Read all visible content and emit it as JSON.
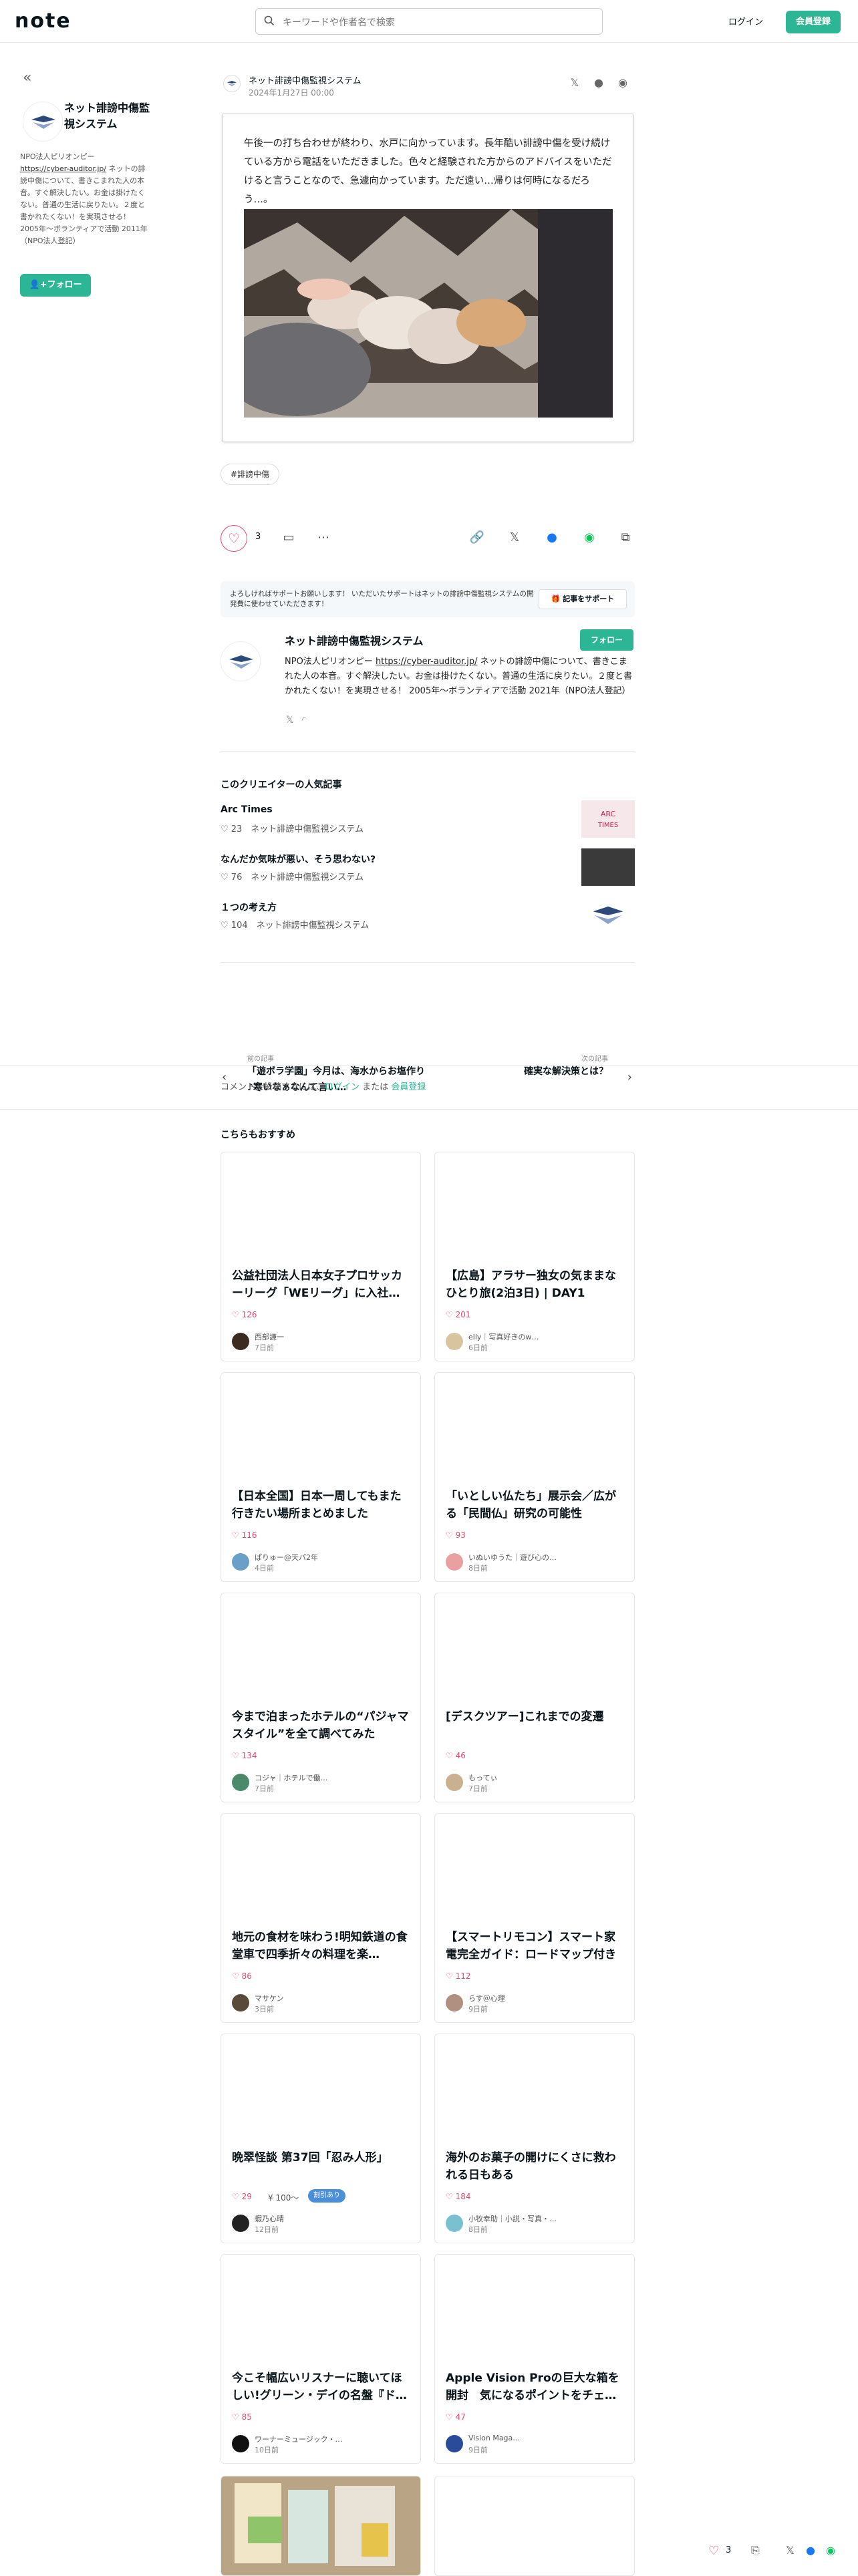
{
  "header": {
    "logo": "note",
    "search_placeholder": "キーワードや作者名で検索",
    "login": "ログイン",
    "signup": "会員登録"
  },
  "sidebar": {
    "name": "ネット誹謗中傷監視システム",
    "bio_pre": "NPO法人ピリオンピー",
    "bio_link": "https://cyber-auditor.jp/",
    "bio_post": " ネットの誹謗中傷について、書きこまれた人の本音。すぐ解決したい。お金は掛けたくない。普通の生活に戻りたい。２度と書かれたくない！を実現させる！ 2005年〜ボランティアで活動 2011年（NPO法人登記）",
    "follow": "フォロー"
  },
  "article": {
    "author": "ネット誹謗中傷監視システム",
    "date": "2024年1月27日 00:00",
    "body": "午後一の打ち合わせが終わり、水戸に向かっています。長年酷い誹謗中傷を受け続けている方から電話をいただきました。色々と経験された方からのアドバイスをいただけると言うことなので、急遽向かっています。ただ遠い…帰りは何時になるだろう…。",
    "tag": "#誹謗中傷",
    "likes": "3"
  },
  "support": {
    "text": "よろしければサポートお願いします！ いただいたサポートはネットの誹謗中傷監視システムの開発費に使わせていただきます！",
    "button": "記事をサポート"
  },
  "profile": {
    "name": "ネット誹謗中傷監視システム",
    "follow": "フォロー",
    "bio_pre": "NPO法人ピリオンピー ",
    "bio_link": "https://cyber-auditor.jp/",
    "bio_post": " ネットの誹謗中傷について、書きこまれた人の本音。すぐ解決したい。お金は掛けたくない。普通の生活に戻りたい。２度と書かれたくない！を実現させる！ 2005年〜ボランティアで活動 2021年（NPO法人登記）"
  },
  "popular": {
    "title": "このクリエイターの人気記事",
    "items": [
      {
        "title": "Arc Times",
        "likes": "23",
        "author": "ネット誹謗中傷監視システム"
      },
      {
        "title": "なんだか気味が悪い、そう思わない?",
        "likes": "76",
        "author": "ネット誹謗中傷監視システム"
      },
      {
        "title": "１つの考え方",
        "likes": "104",
        "author": "ネット誹謗中傷監視システム"
      }
    ]
  },
  "nav": {
    "prev_label": "前の記事",
    "prev_title": "「遊ボラ学園」今月は、海水からお塩作り♪寒いなぁなんて言い…",
    "next_label": "次の記事",
    "next_title": "確実な解決策とは？"
  },
  "comment": {
    "pre": "コメントを投稿するには、",
    "login": "ログイン",
    "mid": " または ",
    "signup": "会員登録"
  },
  "recommend": {
    "title": "こちらもおすすめ",
    "cards": [
      {
        "title": "公益社団法人日本女子プロサッカーリーグ「WEリーグ」に入社…",
        "likes": "126",
        "user": "西部謙一",
        "date": "7日前",
        "avatar": "#3a2a20"
      },
      {
        "title": "【広島】アラサー独女の気ままなひとり旅(2泊3日) | DAY1",
        "likes": "201",
        "user": "elly｜写真好きのw…",
        "date": "6日前",
        "avatar": "#d9c4a0"
      },
      {
        "title": "【日本全国】日本一周してもまた行きたい場所まとめました",
        "likes": "116",
        "user": "ぱりゅー@天パ2年",
        "date": "4日前",
        "avatar": "#6aa0c8"
      },
      {
        "title": "「いとしい仏たち」展示会／広がる「民間仏」研究の可能性",
        "likes": "93",
        "user": "いぬいゆうた｜遊び心の…",
        "date": "8日前",
        "avatar": "#e8a0a0"
      },
      {
        "title": "今まで泊まったホテルの“パジャマスタイル”を全て調べてみた",
        "likes": "134",
        "user": "コジャ｜ホテルで働…",
        "date": "7日前",
        "avatar": "#4a8a6a"
      },
      {
        "title": "[デスクツアー]これまでの変遷",
        "likes": "46",
        "user": "もってぃ",
        "date": "7日前",
        "avatar": "#c8b090"
      },
      {
        "title": "地元の食材を味わう!明知鉄道の食堂車で四季折々の料理を楽…",
        "likes": "86",
        "user": "マサケン",
        "date": "3日前",
        "avatar": "#5a4a3a"
      },
      {
        "title": "【スマートリモコン】スマート家電完全ガイド：ロードマップ付き【…",
        "likes": "112",
        "user": "らす＠心理",
        "date": "9日前",
        "avatar": "#b09080"
      },
      {
        "title": "晩翠怪談 第37回「忍み人形」",
        "likes": "29",
        "pay": "100〜",
        "badge": "割引あり",
        "user": "蝦乃心晴",
        "date": "12日前",
        "avatar": "#222222"
      },
      {
        "title": "海外のお菓子の開けにくさに救われる日もある",
        "likes": "184",
        "user": "小牧幸助｜小説・写真・…",
        "date": "8日前",
        "avatar": "#7ac0d0"
      },
      {
        "title": "今こそ幅広いリスナーに聴いてほしい!グリーン・デイの名盤『ド…",
        "likes": "85",
        "user": "ワーナーミュージック・…",
        "date": "10日前",
        "avatar": "#111111"
      },
      {
        "title": "Apple Vision Proの巨大な箱を開封　気になるポイントをチェ…",
        "likes": "47",
        "user": "Vision Maga…",
        "date": "9日前",
        "avatar": "#2a4a9a"
      }
    ]
  },
  "bottombar": {
    "likes": "3"
  }
}
